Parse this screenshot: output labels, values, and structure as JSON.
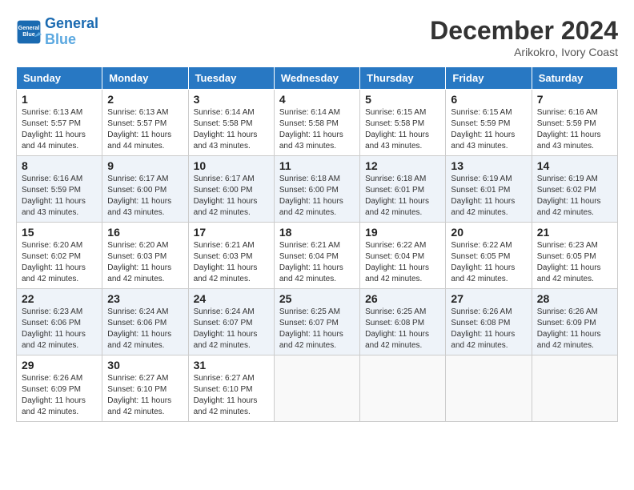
{
  "header": {
    "logo_line1": "General",
    "logo_line2": "Blue",
    "month_title": "December 2024",
    "location": "Arikokro, Ivory Coast"
  },
  "calendar": {
    "days_of_week": [
      "Sunday",
      "Monday",
      "Tuesday",
      "Wednesday",
      "Thursday",
      "Friday",
      "Saturday"
    ],
    "weeks": [
      [
        {
          "day": "",
          "info": ""
        },
        {
          "day": "2",
          "info": "Sunrise: 6:13 AM\nSunset: 5:57 PM\nDaylight: 11 hours and 44 minutes."
        },
        {
          "day": "3",
          "info": "Sunrise: 6:14 AM\nSunset: 5:58 PM\nDaylight: 11 hours and 43 minutes."
        },
        {
          "day": "4",
          "info": "Sunrise: 6:14 AM\nSunset: 5:58 PM\nDaylight: 11 hours and 43 minutes."
        },
        {
          "day": "5",
          "info": "Sunrise: 6:15 AM\nSunset: 5:58 PM\nDaylight: 11 hours and 43 minutes."
        },
        {
          "day": "6",
          "info": "Sunrise: 6:15 AM\nSunset: 5:59 PM\nDaylight: 11 hours and 43 minutes."
        },
        {
          "day": "7",
          "info": "Sunrise: 6:16 AM\nSunset: 5:59 PM\nDaylight: 11 hours and 43 minutes."
        }
      ],
      [
        {
          "day": "1",
          "info": "Sunrise: 6:13 AM\nSunset: 5:57 PM\nDaylight: 11 hours and 44 minutes."
        },
        {
          "day": "9",
          "info": "Sunrise: 6:17 AM\nSunset: 6:00 PM\nDaylight: 11 hours and 43 minutes."
        },
        {
          "day": "10",
          "info": "Sunrise: 6:17 AM\nSunset: 6:00 PM\nDaylight: 11 hours and 42 minutes."
        },
        {
          "day": "11",
          "info": "Sunrise: 6:18 AM\nSunset: 6:00 PM\nDaylight: 11 hours and 42 minutes."
        },
        {
          "day": "12",
          "info": "Sunrise: 6:18 AM\nSunset: 6:01 PM\nDaylight: 11 hours and 42 minutes."
        },
        {
          "day": "13",
          "info": "Sunrise: 6:19 AM\nSunset: 6:01 PM\nDaylight: 11 hours and 42 minutes."
        },
        {
          "day": "14",
          "info": "Sunrise: 6:19 AM\nSunset: 6:02 PM\nDaylight: 11 hours and 42 minutes."
        }
      ],
      [
        {
          "day": "8",
          "info": "Sunrise: 6:16 AM\nSunset: 5:59 PM\nDaylight: 11 hours and 43 minutes."
        },
        {
          "day": "16",
          "info": "Sunrise: 6:20 AM\nSunset: 6:03 PM\nDaylight: 11 hours and 42 minutes."
        },
        {
          "day": "17",
          "info": "Sunrise: 6:21 AM\nSunset: 6:03 PM\nDaylight: 11 hours and 42 minutes."
        },
        {
          "day": "18",
          "info": "Sunrise: 6:21 AM\nSunset: 6:04 PM\nDaylight: 11 hours and 42 minutes."
        },
        {
          "day": "19",
          "info": "Sunrise: 6:22 AM\nSunset: 6:04 PM\nDaylight: 11 hours and 42 minutes."
        },
        {
          "day": "20",
          "info": "Sunrise: 6:22 AM\nSunset: 6:05 PM\nDaylight: 11 hours and 42 minutes."
        },
        {
          "day": "21",
          "info": "Sunrise: 6:23 AM\nSunset: 6:05 PM\nDaylight: 11 hours and 42 minutes."
        }
      ],
      [
        {
          "day": "15",
          "info": "Sunrise: 6:20 AM\nSunset: 6:02 PM\nDaylight: 11 hours and 42 minutes."
        },
        {
          "day": "23",
          "info": "Sunrise: 6:24 AM\nSunset: 6:06 PM\nDaylight: 11 hours and 42 minutes."
        },
        {
          "day": "24",
          "info": "Sunrise: 6:24 AM\nSunset: 6:07 PM\nDaylight: 11 hours and 42 minutes."
        },
        {
          "day": "25",
          "info": "Sunrise: 6:25 AM\nSunset: 6:07 PM\nDaylight: 11 hours and 42 minutes."
        },
        {
          "day": "26",
          "info": "Sunrise: 6:25 AM\nSunset: 6:08 PM\nDaylight: 11 hours and 42 minutes."
        },
        {
          "day": "27",
          "info": "Sunrise: 6:26 AM\nSunset: 6:08 PM\nDaylight: 11 hours and 42 minutes."
        },
        {
          "day": "28",
          "info": "Sunrise: 6:26 AM\nSunset: 6:09 PM\nDaylight: 11 hours and 42 minutes."
        }
      ],
      [
        {
          "day": "22",
          "info": "Sunrise: 6:23 AM\nSunset: 6:06 PM\nDaylight: 11 hours and 42 minutes."
        },
        {
          "day": "30",
          "info": "Sunrise: 6:27 AM\nSunset: 6:10 PM\nDaylight: 11 hours and 42 minutes."
        },
        {
          "day": "31",
          "info": "Sunrise: 6:27 AM\nSunset: 6:10 PM\nDaylight: 11 hours and 42 minutes."
        },
        {
          "day": "",
          "info": ""
        },
        {
          "day": "",
          "info": ""
        },
        {
          "day": "",
          "info": ""
        },
        {
          "day": "",
          "info": ""
        }
      ],
      [
        {
          "day": "29",
          "info": "Sunrise: 6:26 AM\nSunset: 6:09 PM\nDaylight: 11 hours and 42 minutes."
        },
        {
          "day": "",
          "info": ""
        },
        {
          "day": "",
          "info": ""
        },
        {
          "day": "",
          "info": ""
        },
        {
          "day": "",
          "info": ""
        },
        {
          "day": "",
          "info": ""
        },
        {
          "day": "",
          "info": ""
        }
      ]
    ]
  }
}
